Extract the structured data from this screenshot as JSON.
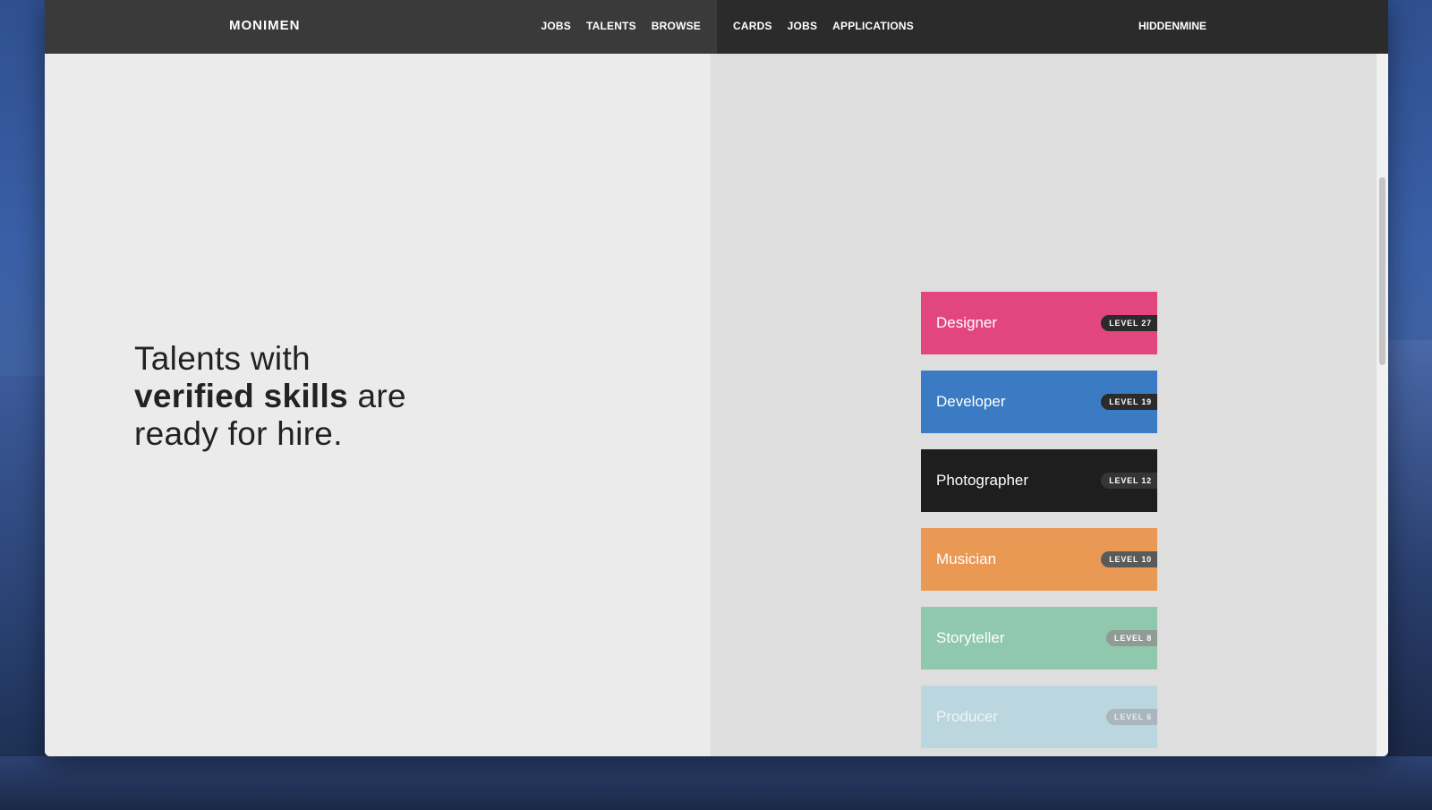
{
  "app": {
    "logo": "MONIMEN",
    "user": "HIDDENMINE"
  },
  "nav_left": [
    "JOBS",
    "TALENTS",
    "BROWSE"
  ],
  "nav_right": [
    "CARDS",
    "JOBS",
    "APPLICATIONS"
  ],
  "hero": {
    "line1": "Talents with",
    "line2_bold": "verified skills",
    "line2_rest": " are",
    "line3": "ready for hire."
  },
  "cards": [
    {
      "title": "Designer",
      "level": "LEVEL 27",
      "color": "#e2467f",
      "badge": "#2b2b2b",
      "text_color": "#ffffff",
      "badge_text": "#ffffff"
    },
    {
      "title": "Developer",
      "level": "LEVEL 19",
      "color": "#3a7bc3",
      "badge": "#2b2b2b",
      "text_color": "#ffffff",
      "badge_text": "#ffffff"
    },
    {
      "title": "Photographer",
      "level": "LEVEL 12",
      "color": "#1e1e1e",
      "badge": "#353535",
      "text_color": "#ffffff",
      "badge_text": "#ffffff"
    },
    {
      "title": "Musician",
      "level": "LEVEL 10",
      "color": "#ea9955",
      "badge": "#5a5a5a",
      "text_color": "#ffffff",
      "badge_text": "#ffffff"
    },
    {
      "title": "Storyteller",
      "level": "LEVEL 8",
      "color": "#8fc8ad",
      "badge": "#8f9c95",
      "text_color": "#ffffff",
      "badge_text": "#ffffff"
    },
    {
      "title": "Producer",
      "level": "LEVEL 6",
      "color": "#bcd6e0",
      "badge": "#a9b6bb",
      "text_color": "#eef4f6",
      "badge_text": "#e6edef"
    }
  ]
}
